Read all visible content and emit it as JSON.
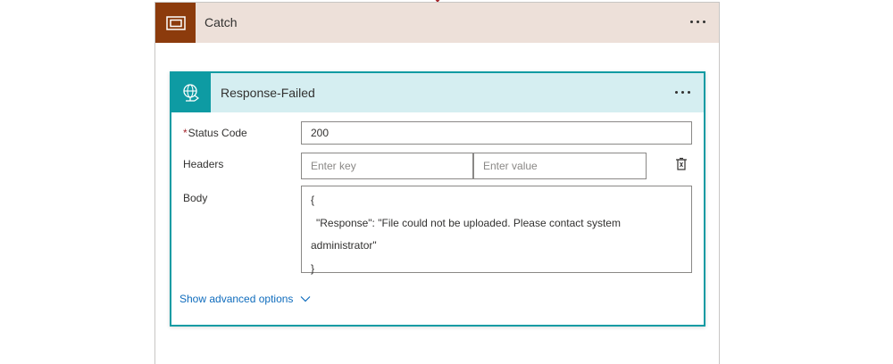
{
  "catch_scope": {
    "title": "Catch",
    "icon": "scope-icon",
    "colors": {
      "header_bg": "#ede0d9",
      "icon_bg": "#8c3b0c"
    }
  },
  "response_action": {
    "title": "Response-Failed",
    "icon": "globe-response-icon",
    "colors": {
      "header_bg": "#d5eef1",
      "accent": "#0e9ba3"
    },
    "fields": {
      "status_code": {
        "required_mark": "*",
        "label": "Status Code",
        "value": "200"
      },
      "headers": {
        "label": "Headers",
        "key_placeholder": "Enter key",
        "value_placeholder": "Enter value"
      },
      "body": {
        "label": "Body",
        "lines": [
          "{",
          "\"Response\": \"File could not be uploaded. Please contact system",
          "administrator\"",
          "}"
        ]
      }
    },
    "advanced_link": "Show advanced options"
  }
}
